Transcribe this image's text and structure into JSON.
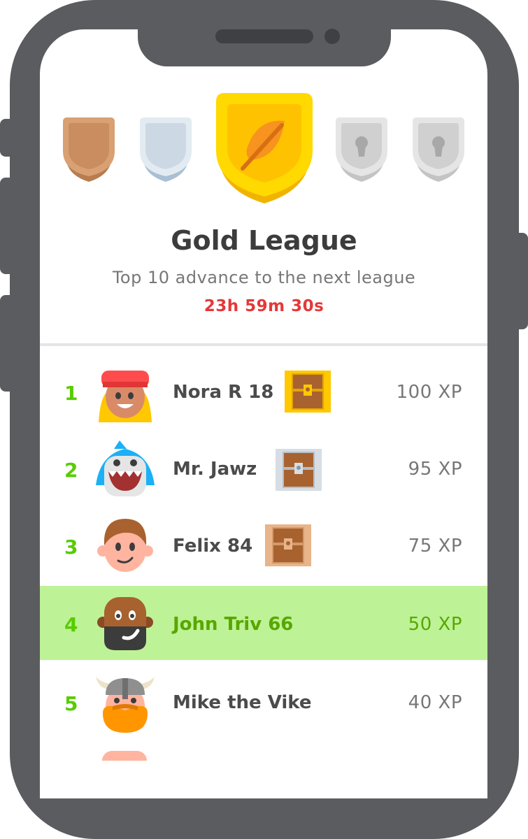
{
  "league": {
    "title": "Gold League",
    "subtitle": "Top 10 advance to the next league",
    "timer": "23h 59m 30s",
    "badges": [
      "bronze",
      "silver",
      "gold-feather-icon",
      "locked",
      "locked"
    ]
  },
  "leaderboard": [
    {
      "rank": "1",
      "name": "Nora R 18",
      "xp": "100 XP",
      "chest": "gold"
    },
    {
      "rank": "2",
      "name": "Mr. Jawz",
      "xp": "95 XP",
      "chest": "silver"
    },
    {
      "rank": "3",
      "name": "Felix 84",
      "xp": "75 XP",
      "chest": "bronze"
    },
    {
      "rank": "4",
      "name": "John Triv 66",
      "xp": "50 XP",
      "current_user": true
    },
    {
      "rank": "5",
      "name": "Mike the Vike",
      "xp": "40 XP"
    }
  ],
  "colors": {
    "rank_green": "#58cc02",
    "highlight_row": "#bef296",
    "timer_red": "#e53838",
    "gold": "#ffc800"
  }
}
